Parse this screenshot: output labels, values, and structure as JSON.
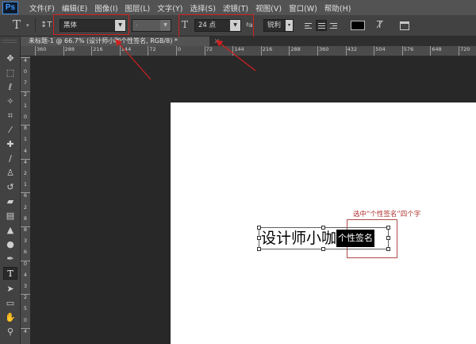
{
  "menubar": {
    "logo": "Ps",
    "items": [
      "文件(F)",
      "编辑(E)",
      "图像(I)",
      "图层(L)",
      "文字(Y)",
      "选择(S)",
      "滤镜(T)",
      "视图(V)",
      "窗口(W)",
      "帮助(H)"
    ]
  },
  "options_bar": {
    "tool_glyph": "T",
    "orientation_glyph": "↕T",
    "font_family": "黑体",
    "font_style": "-",
    "size_glyph": "T",
    "font_size": "24 点",
    "aa_label": "ªa",
    "antialias": "锐利",
    "text_color": "#000000"
  },
  "document_tab": {
    "title": "未标题-1 @ 66.7% (设计师小咖个性签名, RGB/8) *",
    "close": "×"
  },
  "ruler_h": {
    "labels": [
      "360",
      "288",
      "216",
      "144",
      "72",
      "0",
      "72",
      "144",
      "216",
      "288",
      "360",
      "432",
      "504",
      "576",
      "648",
      "720"
    ]
  },
  "ruler_v": {
    "labels": [
      "4",
      "0",
      "7",
      "2",
      "1",
      "0",
      "8",
      "1",
      "4",
      "4",
      "2",
      "1",
      "6",
      "2",
      "8",
      "8",
      "3",
      "6",
      "0",
      "4",
      "3",
      "2",
      "5",
      "0",
      "4"
    ]
  },
  "canvas": {
    "text_normal": "设计师小咖",
    "text_selected": "个性签名",
    "annotation": "选中“个性签名”四个字"
  },
  "colors": {
    "menubar_bg": "#535353",
    "optbar_bg": "#424242",
    "workspace_bg": "#282828",
    "highlight_red": "#d02020"
  }
}
